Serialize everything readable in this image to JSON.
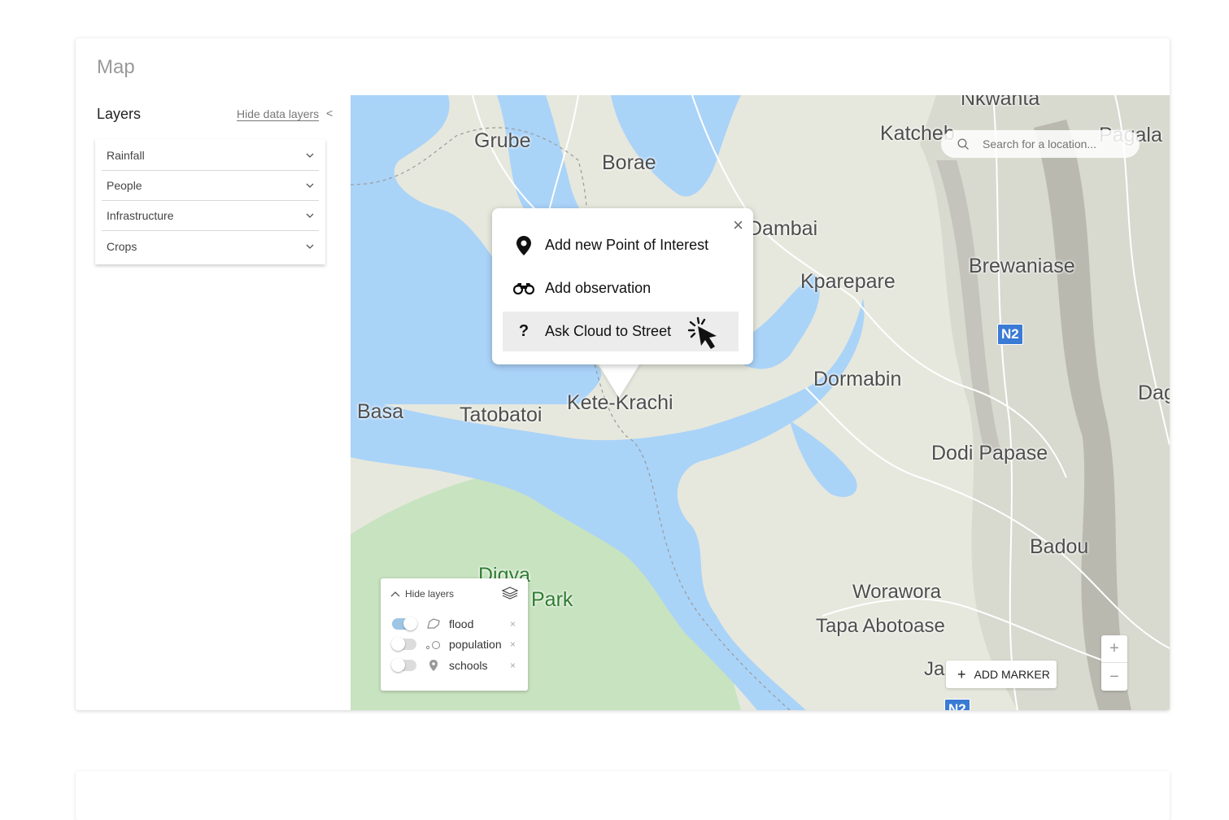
{
  "page": {
    "title": "Map"
  },
  "sidebar": {
    "title": "Layers",
    "hide_label": "Hide data layers",
    "items": [
      {
        "label": "Rainfall"
      },
      {
        "label": "People"
      },
      {
        "label": "Infrastructure"
      },
      {
        "label": "Crops"
      }
    ]
  },
  "map": {
    "search_placeholder": "Search for a location...",
    "places": {
      "nkwanta": "Nkwanta",
      "grube": "Grube",
      "borae": "Borae",
      "katcheb": "Katcheb",
      "pagala": "Pagala",
      "dambai": "Dambai",
      "brewaniase": "Brewaniase",
      "kparepare": "Kparepare",
      "dormabin": "Dormabin",
      "dag": "Dag",
      "basa": "Basa",
      "tatobatoi": "Tatobatoi",
      "kete_krachi": "Kete-Krachi",
      "dodi_papase": "Dodi Papase",
      "badou": "Badou",
      "digya": "Digya",
      "park": "Park",
      "worawora": "Worawora",
      "tapa_abotoase": "Tapa Abotoase",
      "ja": "Ja"
    },
    "road_shields": {
      "n2": "N2",
      "n2b": "N2"
    },
    "colors": {
      "water": "#aad3f8",
      "land": "#e6e8dd",
      "park": "#c8e3c0",
      "road": "#ffffff"
    }
  },
  "popup": {
    "items": [
      {
        "label": "Add new Point of Interest",
        "icon": "map-pin-icon"
      },
      {
        "label": "Add observation",
        "icon": "binoculars-icon"
      },
      {
        "label": "Ask Cloud to Street",
        "icon": "question-icon"
      }
    ],
    "close": "×"
  },
  "layer_panel": {
    "header": "Hide layers",
    "rows": [
      {
        "label": "flood",
        "on": true,
        "remove": "×"
      },
      {
        "label": "population",
        "on": false,
        "remove": "×"
      },
      {
        "label": "schools",
        "on": false,
        "remove": "×"
      }
    ]
  },
  "controls": {
    "add_marker": "ADD MARKER",
    "add_marker_plus": "+",
    "zoom_in": "+",
    "zoom_out": "−"
  }
}
